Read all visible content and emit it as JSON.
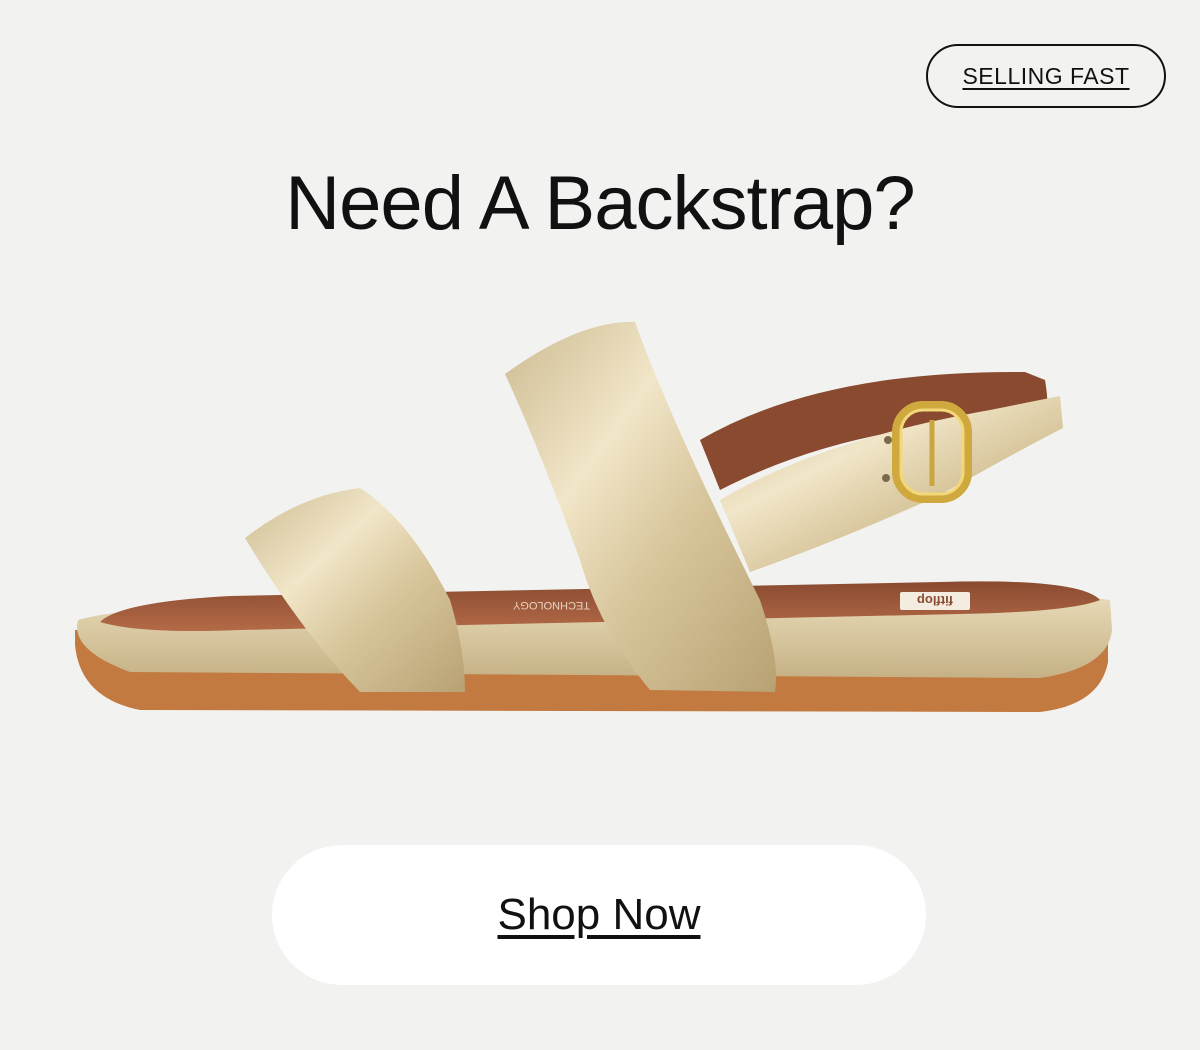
{
  "badge": {
    "label": "SELLING FAST"
  },
  "headline": "Need A Backstrap?",
  "product": {
    "insole_brand": "fitflop",
    "insole_text": "TECHNOLOGY",
    "colors": {
      "metallic_gold": "#d9c9a3",
      "footbed_tan": "#9c5a3c",
      "outsole": "#c47a3f",
      "buckle": "#d8b64a"
    }
  },
  "cta": {
    "label": "Shop Now"
  },
  "colors": {
    "background": "#f2f2f0",
    "text": "#111111",
    "button_bg": "#ffffff"
  }
}
